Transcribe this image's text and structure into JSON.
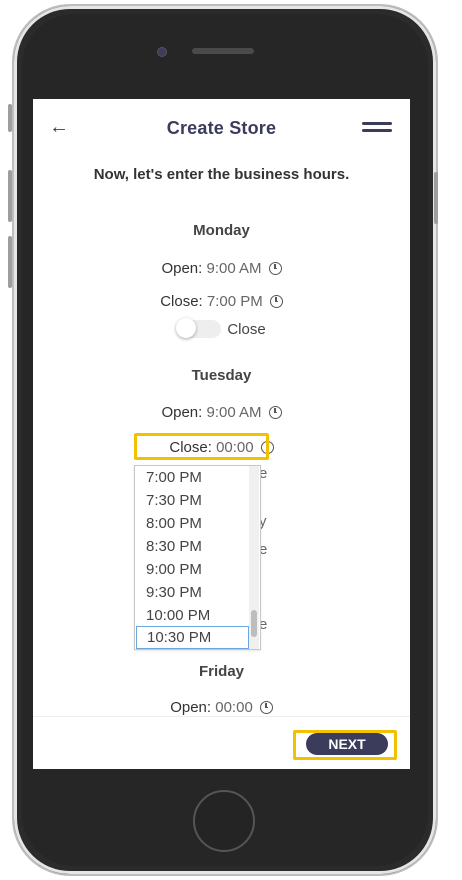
{
  "header": {
    "title": "Create Store",
    "back_icon": "arrow-left-icon",
    "menu_icon": "hamburger-menu-icon"
  },
  "intro": "Now, let's enter the business hours.",
  "days": {
    "monday": {
      "name": "Monday",
      "open_label": "Open:",
      "open_value": "9:00 AM",
      "close_label": "Close:",
      "close_value": "7:00 PM",
      "toggle_label": "Close"
    },
    "tuesday": {
      "name": "Tuesday",
      "open_label": "Open:",
      "open_value": "9:00 AM",
      "close_label": "Close:",
      "close_value": "00:00"
    },
    "friday": {
      "name": "Friday",
      "open_label": "Open:",
      "open_value": "00:00"
    }
  },
  "dropdown": {
    "options": [
      "7:00 PM",
      "7:30 PM",
      "8:00 PM",
      "8:30 PM",
      "9:00 PM",
      "9:30 PM",
      "10:00 PM",
      "10:30 PM"
    ],
    "selected": "10:30 PM"
  },
  "peek_text": {
    "a": "e",
    "b": "y",
    "c": "e",
    "d": "e"
  },
  "footer": {
    "next_label": "NEXT"
  },
  "colors": {
    "brand": "#3b3b5c",
    "highlight": "#f2c200",
    "selection_border": "#6aa6df"
  }
}
